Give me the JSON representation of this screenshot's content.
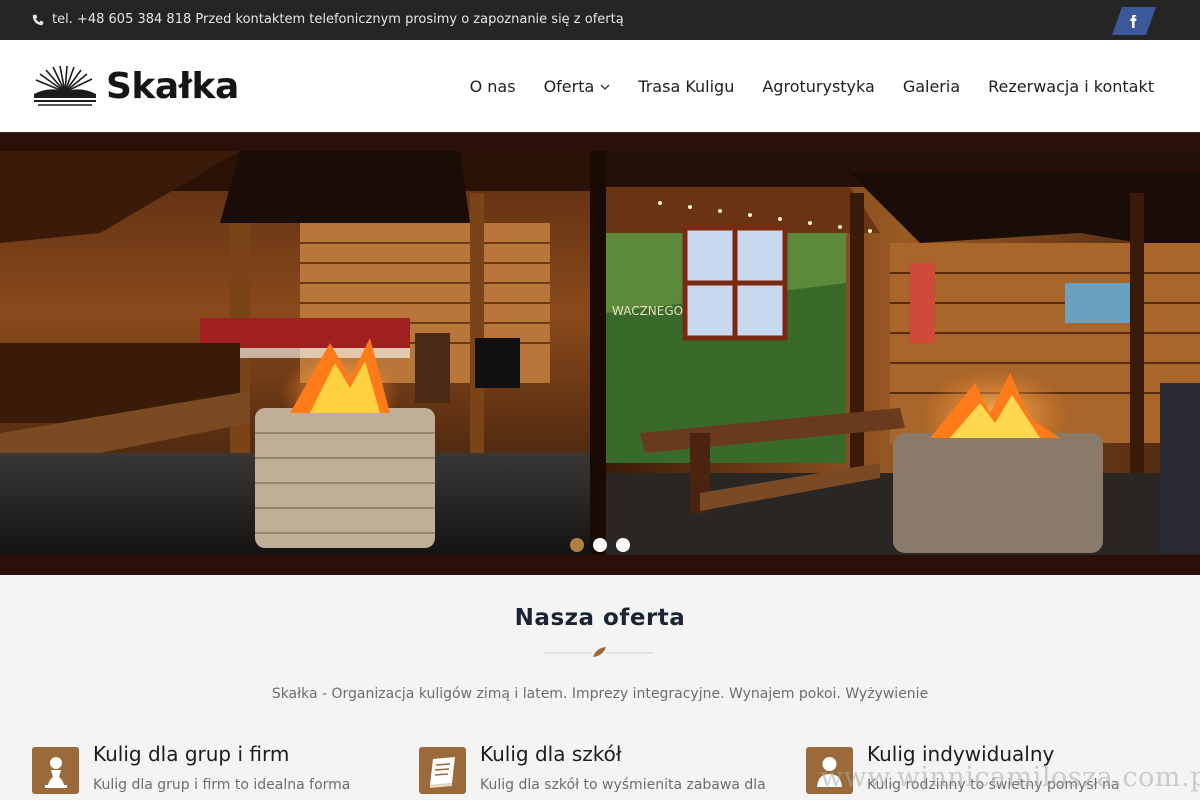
{
  "topbar": {
    "phone_text": "tel. +48 605 384 818 Przed kontaktem telefonicznym prosimy o zapoznanie się z ofertą",
    "facebook_icon": "facebook-icon"
  },
  "header": {
    "logo_text": "Skałka",
    "nav": [
      {
        "label": "O nas"
      },
      {
        "label": "Oferta"
      },
      {
        "label": "Trasa Kuligu"
      },
      {
        "label": "Agroturystyka"
      },
      {
        "label": "Galeria"
      },
      {
        "label": "Rezerwacja i kontakt"
      }
    ]
  },
  "hero": {
    "slide_count": 3,
    "active_slide": 1
  },
  "offer_section": {
    "title": "Nasza oferta",
    "subtitle": "Skałka - Organizacja kuligów zimą i latem. Imprezy integracyjne. Wynajem pokoi. Wyżywienie",
    "items": [
      {
        "icon": "chess-pawn-icon",
        "title": "Kulig dla grup i firm",
        "desc": "Kulig dla grup i firm to idealna forma"
      },
      {
        "icon": "notebook-icon",
        "title": "Kulig dla szkół",
        "desc": "Kulig dla szkół to wyśmienita zabawa dla"
      },
      {
        "icon": "user-icon",
        "title": "Kulig indywidualny",
        "desc": "Kulig rodzinny to świetny pomysł na"
      }
    ]
  },
  "watermark": "www.winnicamilosza.com.pl",
  "colors": {
    "topbar_bg": "#252525",
    "accent_brown": "#9a6a3a",
    "facebook_blue": "#3b5998",
    "active_dot": "#b08044"
  }
}
